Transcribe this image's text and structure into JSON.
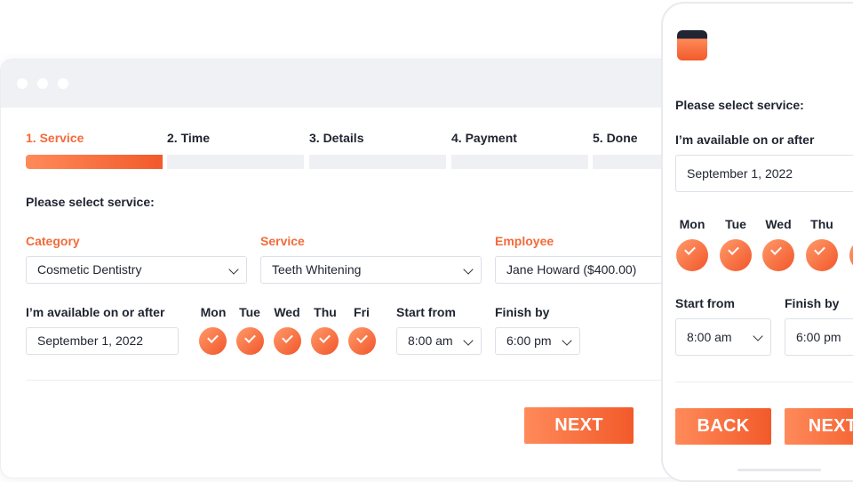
{
  "steps": [
    {
      "label": "1. Service",
      "active": true
    },
    {
      "label": "2. Time",
      "active": false
    },
    {
      "label": "3. Details",
      "active": false
    },
    {
      "label": "4. Payment",
      "active": false
    },
    {
      "label": "5. Done",
      "active": false
    }
  ],
  "form": {
    "title": "Please select service:",
    "category_label": "Category",
    "category_value": "Cosmetic Dentistry",
    "service_label": "Service",
    "service_value": "Teeth Whitening",
    "employee_label": "Employee",
    "employee_value": "Jane Howard ($400.00)",
    "available_label": "I’m available on or after",
    "date_value": "September 1, 2022",
    "days": [
      "Mon",
      "Tue",
      "Wed",
      "Thu",
      "Fri"
    ],
    "start_label": "Start from",
    "start_value": "8:00 am",
    "finish_label": "Finish by",
    "finish_value": "6:00 pm",
    "next_label": "NEXT"
  },
  "mobile": {
    "title": "Please select service:",
    "available_label": "I’m available on or after",
    "date_value": "September 1, 2022",
    "days": [
      "Mon",
      "Tue",
      "Wed",
      "Thu"
    ],
    "start_label": "Start from",
    "start_value": "8:00 am",
    "finish_label": "Finish by",
    "finish_value": "6:00 pm",
    "back_label": "BACK",
    "next_label": "NEXT"
  },
  "colors": {
    "accent": "#f26b3a",
    "accent_gradient_start": "#ff8a5a",
    "accent_gradient_end": "#f25a2a",
    "inactive_bar": "#eef0f4",
    "text": "#1f2430"
  }
}
